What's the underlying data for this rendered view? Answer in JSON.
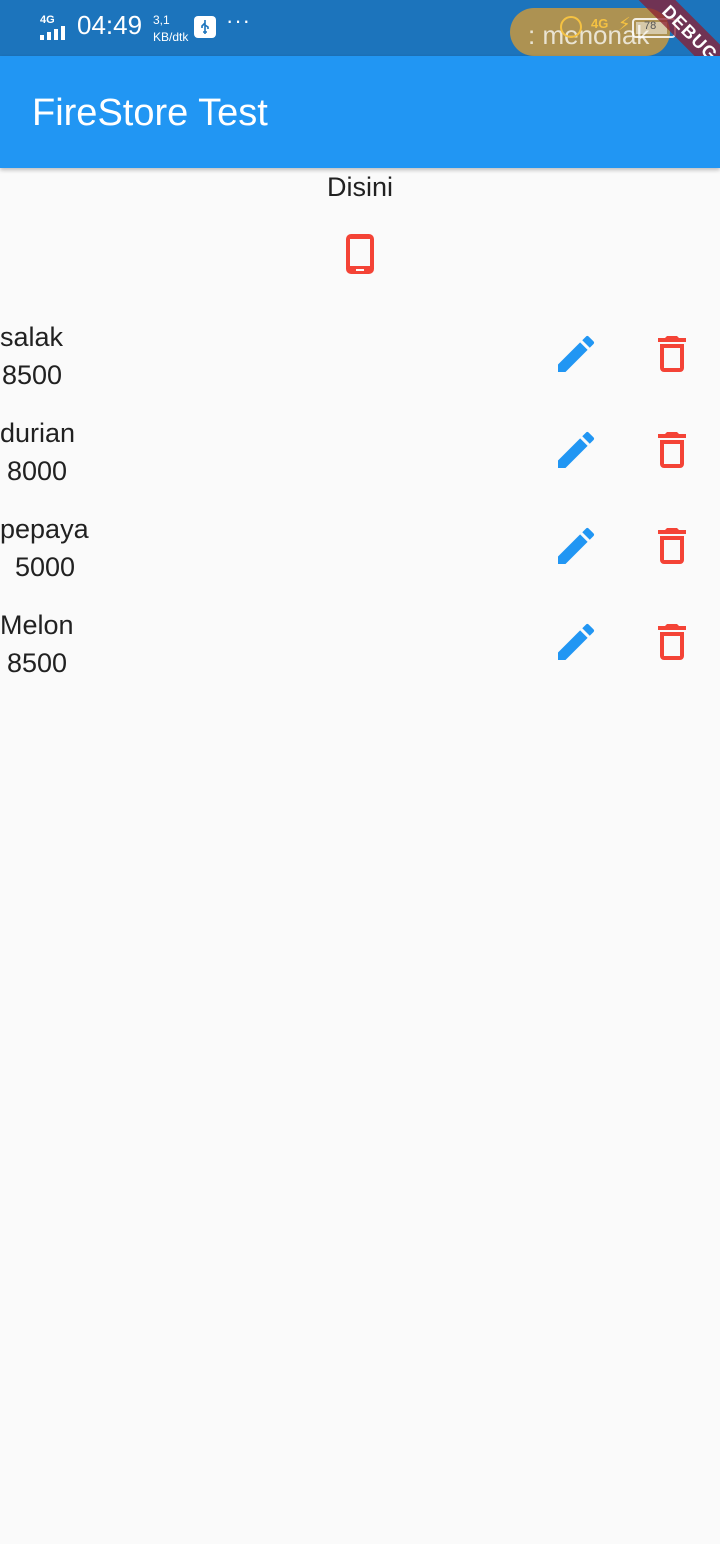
{
  "status_bar": {
    "network": "4G",
    "time": "04:49",
    "speed_value": "3,1",
    "speed_unit": "KB/dtk",
    "more": "···",
    "toast": ": menonak",
    "network_right": "4G",
    "battery_level": "78"
  },
  "debug_banner": "DEBUG",
  "app_bar": {
    "title": "FireStore Test"
  },
  "header": {
    "text": "Disini"
  },
  "icons": {
    "phone": "smartphone-icon",
    "edit": "pencil-icon",
    "delete": "trash-icon"
  },
  "colors": {
    "app_bar": "#2196f3",
    "status_bar": "#1c74bc",
    "edit": "#2196f3",
    "delete": "#f44336",
    "background": "#fafafa"
  },
  "items": [
    {
      "name": "salak",
      "price": "8500"
    },
    {
      "name": "durian",
      "price": "8000"
    },
    {
      "name": "pepaya",
      "price": "5000"
    },
    {
      "name": "Melon",
      "price": "8500"
    }
  ]
}
